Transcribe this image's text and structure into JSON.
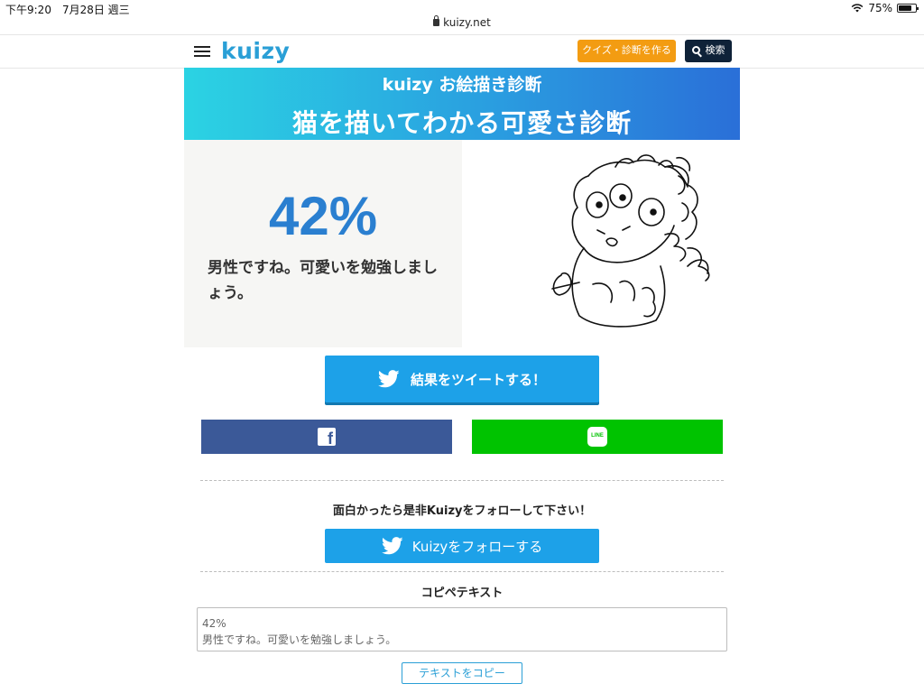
{
  "status_bar": {
    "time_date": "下午9:20　7月28日 週三",
    "battery": "75%"
  },
  "browser": {
    "url": "kuizy.net"
  },
  "header": {
    "logo": "kuizy",
    "create_label": "クイズ・診断を作る",
    "search_label": "検索"
  },
  "banner": {
    "subtitle": "kuizy お絵描き診断",
    "title": "猫を描いてわかる可愛さ診断"
  },
  "result": {
    "percent": "42%",
    "message": "男性ですね。可愛いを勉強しましょう。"
  },
  "share": {
    "tweet_label": "結果をツイートする！",
    "facebook_icon": "facebook-icon",
    "line_icon_text": "LINE"
  },
  "follow": {
    "prompt": "面白かったら是非Kuizyをフォローして下さい！",
    "button_label": "Kuizyをフォローする"
  },
  "copy": {
    "title": "コピペテキスト",
    "text": "42%\n男性ですね。可愛いを勉強しましょう。",
    "button_label": "テキストをコピー"
  },
  "colors": {
    "brand": "#2a9fd6",
    "twitter": "#1da1e8",
    "facebook": "#3b5998",
    "line": "#00c300",
    "create_button": "#f39c12",
    "search_button": "#0f2238"
  }
}
